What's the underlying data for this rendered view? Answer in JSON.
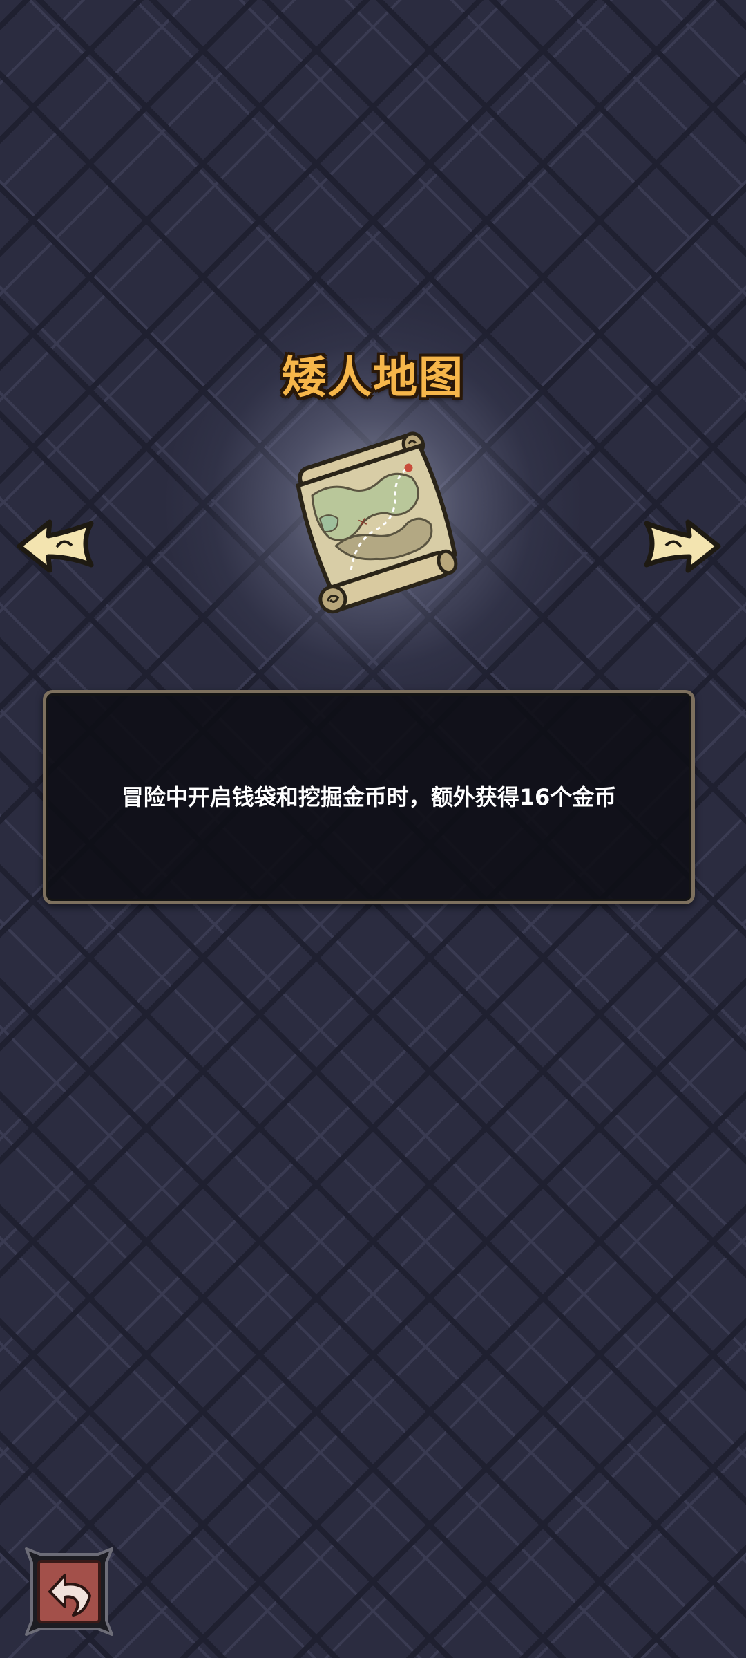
{
  "item": {
    "name": "矮人地图",
    "description": "冒险中开启钱袋和挖掘金币时，额外获得16个金币"
  },
  "icons": {
    "item_image": "treasure-map-scroll-icon",
    "prev": "arrow-left-icon",
    "next": "arrow-right-icon",
    "back": "return-arrow-icon"
  },
  "colors": {
    "title": "#f6b64a",
    "background": "#2b2c40",
    "panel_border": "#7d705e",
    "back_button": "#a3504a"
  }
}
